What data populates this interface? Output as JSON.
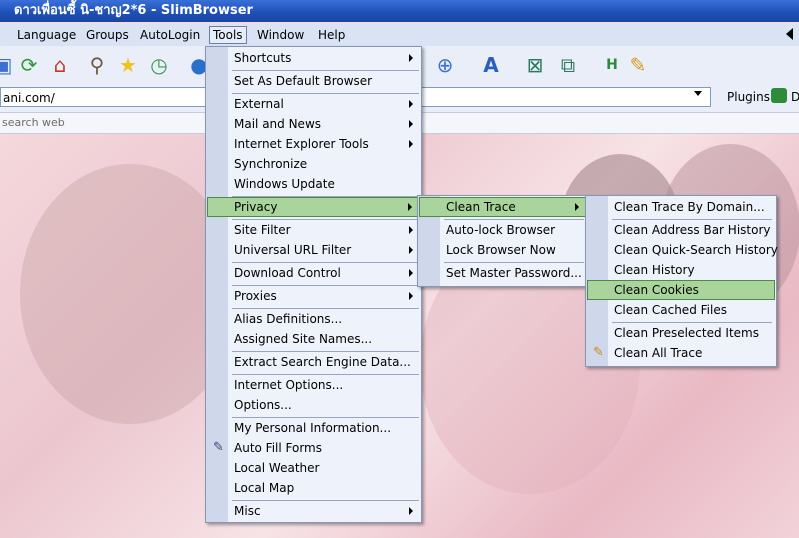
{
  "window": {
    "title": "ดาวเพื่อนซี้ นิ-ชาญ2*6 - SlimBrowser"
  },
  "menubar": {
    "items": [
      "Language",
      "Groups",
      "AutoLogin",
      "Tools",
      "Window",
      "Help"
    ],
    "active": "Tools"
  },
  "address": {
    "value": "ani.com/"
  },
  "plugins": {
    "label": "Plugins",
    "trailing": "D"
  },
  "search": {
    "placeholder": "search web"
  },
  "tools_menu": {
    "items": [
      "Shortcuts",
      "Set As Default Browser",
      "External",
      "Mail and News",
      "Internet Explorer Tools",
      "Synchronize",
      "Windows Update",
      "Privacy",
      "Site Filter",
      "Universal URL Filter",
      "Download Control",
      "Proxies",
      "Alias Definitions...",
      "Assigned Site Names...",
      "Extract Search Engine Data...",
      "Internet Options...",
      "Options...",
      "My Personal Information...",
      "Auto Fill Forms",
      "Local Weather",
      "Local Map",
      "Misc"
    ],
    "highlighted": "Privacy"
  },
  "privacy_menu": {
    "items": [
      "Clean Trace",
      "Auto-lock Browser",
      "Lock Browser Now",
      "Set Master Password..."
    ],
    "highlighted": "Clean Trace"
  },
  "clean_trace_menu": {
    "items": [
      "Clean Trace By Domain...",
      "Clean Address Bar History",
      "Clean Quick-Search History",
      "Clean History",
      "Clean Cookies",
      "Clean Cached Files",
      "Clean Preselected Items",
      "Clean All Trace"
    ],
    "highlighted": "Clean Cookies"
  },
  "colors": {
    "title_bar": "#1d4fb6",
    "menu_highlight": "#a9d59c",
    "menu_gutter": "#cfd8ea"
  }
}
